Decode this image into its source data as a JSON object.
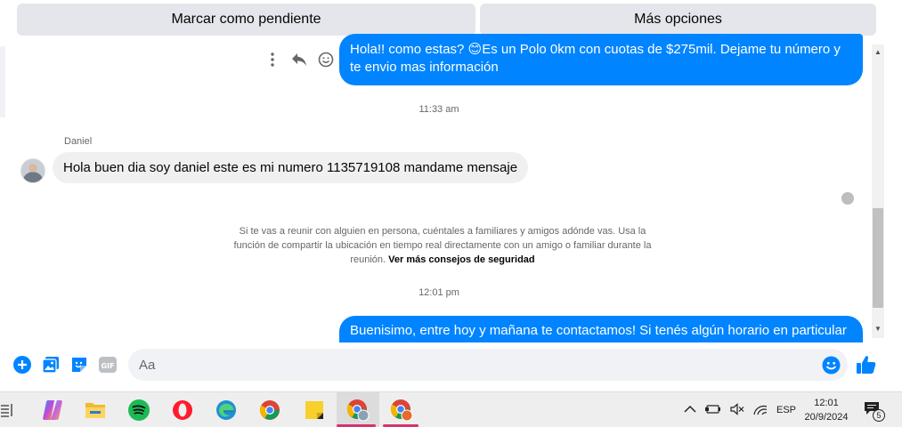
{
  "toolbar": {
    "mark_pending": "Marcar como pendiente",
    "more_options": "Más opciones"
  },
  "messages": {
    "out_1": "Hola!! como estas? 😊Es un Polo 0km con cuotas de $275mil. Dejame tu número y te envio mas información",
    "time_1": "11:33 am",
    "sender": "Daniel",
    "in_1": "Hola buen dia soy daniel este es mi numero 1135719108 mandame mensaje",
    "safety_text": "Si te vas a reunir con alguien en persona, cuéntales a familiares y amigos adónde vas. Usa la función de compartir la ubicación en tiempo real directamente con un amigo o familiar durante la reunión.",
    "safety_link": "Ver más consejos de seguridad",
    "time_2": "12:01 pm",
    "out_2": "Buenisimo, entre hoy y mañana te contactamos! Si tenés algún horario en particular"
  },
  "composer": {
    "placeholder": "Aa"
  },
  "taskbar": {
    "language": "ESP",
    "time": "12:01",
    "date": "20/9/2024",
    "notification_count": "5"
  },
  "colors": {
    "messenger_blue": "#0084ff",
    "incoming_bubble": "#f0f0f0",
    "button_gray": "#e4e6eb"
  }
}
